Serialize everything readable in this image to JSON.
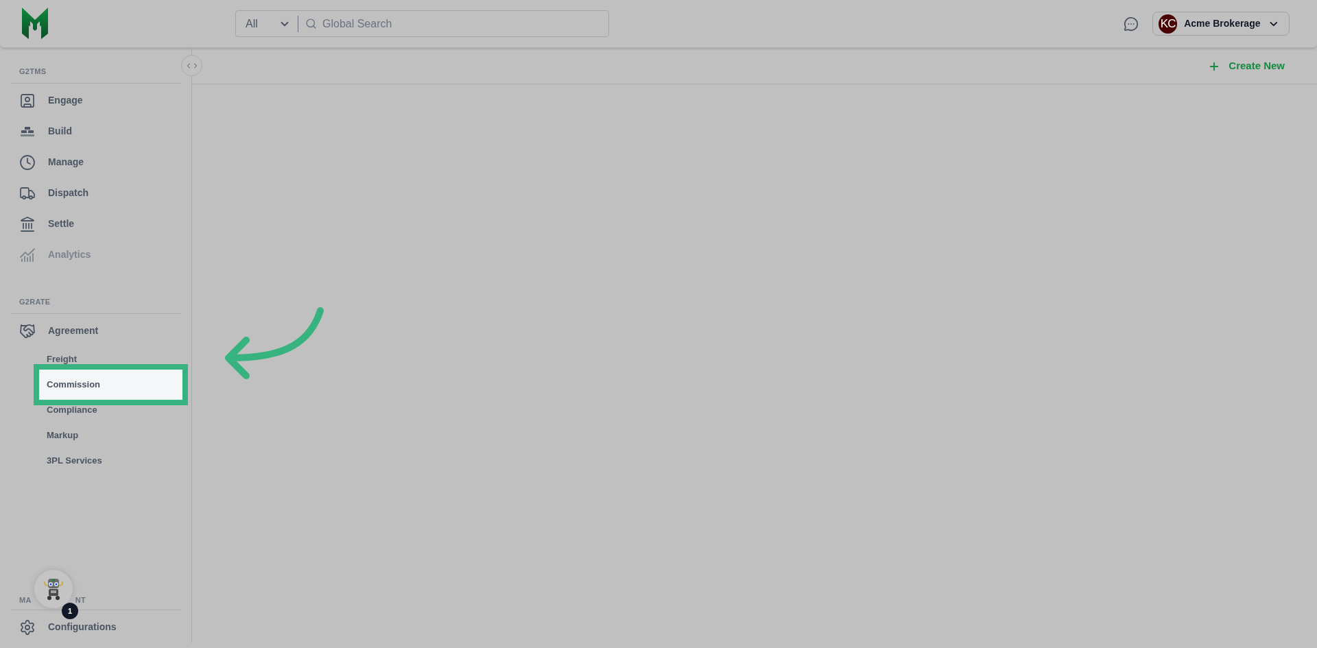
{
  "header": {
    "search": {
      "scope": "All",
      "placeholder": "Global Search"
    },
    "account": {
      "initials": "KC",
      "name": "Acme Brokerage"
    }
  },
  "sidebar": {
    "sections": [
      {
        "label": "G2TMS",
        "items": [
          {
            "label": "Engage",
            "disabled": false,
            "selected": false
          },
          {
            "label": "Build",
            "disabled": false,
            "selected": false
          },
          {
            "label": "Manage",
            "disabled": false,
            "selected": false
          },
          {
            "label": "Dispatch",
            "disabled": false,
            "selected": false
          },
          {
            "label": "Settle",
            "disabled": false,
            "selected": false
          },
          {
            "label": "Analytics",
            "disabled": true,
            "selected": false
          }
        ]
      },
      {
        "label": "G2RATE",
        "items": [
          {
            "label": "Agreement",
            "disabled": false,
            "selected": false,
            "children": [
              {
                "label": "Freight",
                "selected": false
              },
              {
                "label": "Commission",
                "selected": true
              },
              {
                "label": "Compliance",
                "selected": false
              },
              {
                "label": "Markup",
                "selected": false
              },
              {
                "label": "3PL Services",
                "selected": false
              }
            ]
          }
        ]
      },
      {
        "label_parts": [
          "MA",
          "NT"
        ],
        "items": [
          {
            "label": "Configurations",
            "disabled": false,
            "selected": false
          }
        ]
      }
    ]
  },
  "toolbar": {
    "create_button": "Create New"
  },
  "assistant": {
    "badge": "1"
  }
}
